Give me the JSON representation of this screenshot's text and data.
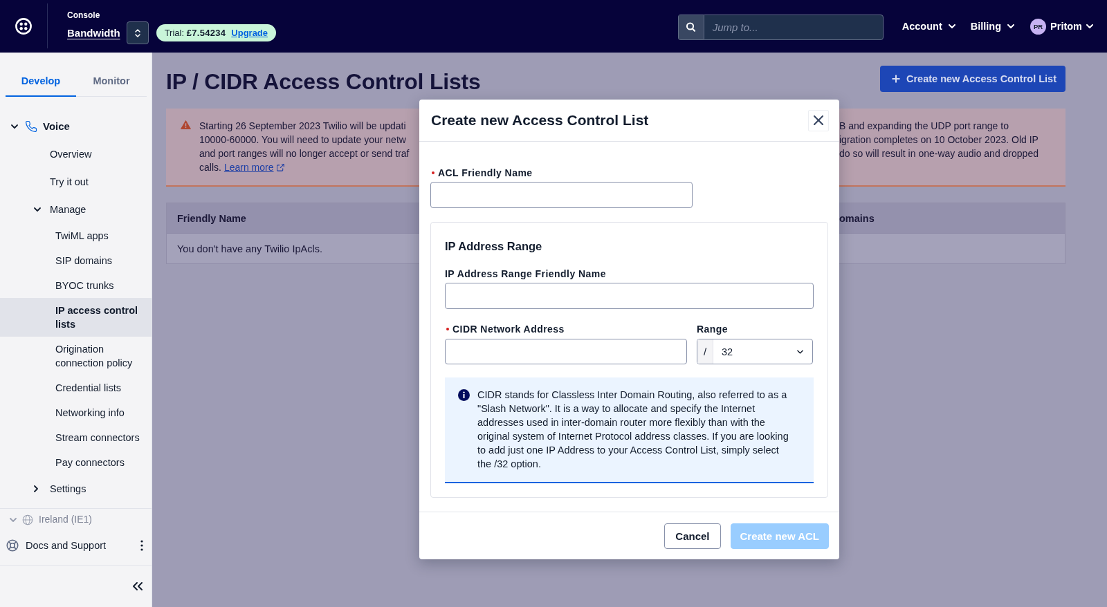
{
  "top_bar": {
    "console_label": "Console",
    "project": "Bandwidth",
    "trial": {
      "balance": "Trial: **£7.54234**",
      "link": "Upgrade"
    },
    "search": {
      "placeholder": "Jump to..."
    },
    "menus": [
      {
        "label": "Account"
      },
      {
        "label": "Billing"
      }
    ],
    "user": {
      "initials": "PR",
      "name": "Pritom"
    }
  },
  "sidebar": {
    "tabs": [
      {
        "label": "Develop",
        "selected": true
      },
      {
        "label": "Monitor",
        "selected": false
      }
    ],
    "nav": [
      {
        "label": "Voice",
        "expanded": true,
        "selected": false,
        "children": [
          {
            "label": "Overview",
            "selected": false
          },
          {
            "label": "Try it out",
            "selected": false
          },
          {
            "label": "Manage",
            "expanded": true,
            "selected": false,
            "children": [
              {
                "label": "TwiML apps",
                "selected": false
              },
              {
                "label": "SIP domains",
                "selected": false
              },
              {
                "label": "BYOC trunks",
                "selected": false
              },
              {
                "label": "IP access control lists",
                "selected": true
              },
              {
                "label": "Origination connection policy",
                "selected": false
              },
              {
                "label": "Credential lists",
                "selected": false
              },
              {
                "label": "Networking info",
                "selected": false
              },
              {
                "label": "Stream connectors",
                "selected": false
              },
              {
                "label": "Pay connectors",
                "selected": false
              }
            ]
          },
          {
            "label": "Settings",
            "expanded": false,
            "selected": false
          }
        ]
      }
    ],
    "region": {
      "label": "Ireland (IE1)",
      "expanded": true
    },
    "footer": {
      "label": "Docs and Support"
    }
  },
  "page": {
    "title": "IP / CIDR Access Control Lists",
    "create_button": "Create new Access Control List",
    "banner": {
      "left_lines": [
        "Starting 26 September 2023 Twilio will be updati",
        "10000-60000. You will need to update your netw",
        "and port ranges will no longer accept or send traf",
        "calls."
      ],
      "link": "Learn more",
      "right_lines": [
        "B and expanding the UDP port range to",
        "igration completes on 10 October 2023. Old IP",
        "do so will result in one-way audio and dropped"
      ]
    },
    "table": {
      "columns": [
        "Friendly Name",
        "omains"
      ],
      "empty_message": "You don't have any Twilio IpAcls."
    }
  },
  "modal": {
    "title": "Create new Access Control List",
    "name_field": {
      "label": "ACL Friendly Name",
      "required": true
    },
    "section": {
      "title": "IP Address Range",
      "name_field": {
        "label": "IP Address Range Friendly Name",
        "required": false
      },
      "address_field": {
        "label": "CIDR Network Address",
        "required": true
      },
      "range_field": {
        "label": "Range",
        "prefix": "/",
        "value": "32"
      },
      "info": "CIDR stands for Classless Inter Domain Routing, also referred to as a \"Slash Network\". It is a way to allocate and specify the Internet addresses used in inter-domain router more flexibly than with the original system of Internet Protocol address classes. If you are looking to add just one IP Address to your Access Control List, simply select the /32 option."
    },
    "buttons": [
      {
        "label": "Cancel",
        "kind": "secondary",
        "disabled": false
      },
      {
        "label": "Create new ACL",
        "kind": "primary",
        "disabled": true
      }
    ]
  }
}
